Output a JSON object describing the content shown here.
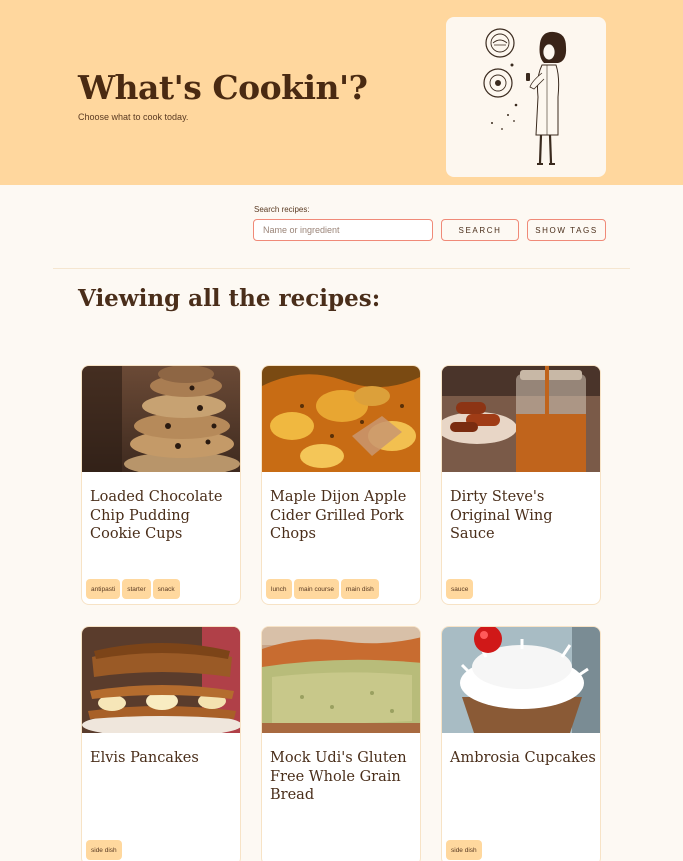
{
  "header": {
    "title": "What's Cookin'?",
    "subtitle": "Choose what to cook today."
  },
  "search": {
    "label": "Search recipes:",
    "placeholder": "Name or ingredient",
    "search_button": "SEARCH",
    "tags_button": "SHOW TAGS"
  },
  "main": {
    "heading": "Viewing all the recipes:"
  },
  "recipes": [
    {
      "title": "Loaded Chocolate Chip Pudding Cookie Cups",
      "tags": [
        "antipasti",
        "starter",
        "snack"
      ]
    },
    {
      "title": "Maple Dijon Apple Cider Grilled Pork Chops",
      "tags": [
        "lunch",
        "main course",
        "main dish"
      ]
    },
    {
      "title": "Dirty Steve's Original Wing Sauce",
      "tags": [
        "sauce"
      ]
    },
    {
      "title": "Elvis Pancakes",
      "tags": [
        "side dish"
      ]
    },
    {
      "title": "Mock Udi's Gluten Free Whole Grain Bread",
      "tags": []
    },
    {
      "title": "Ambrosia Cupcakes",
      "tags": [
        "side dish"
      ]
    }
  ],
  "colors": {
    "header_bg": "#ffd79e",
    "page_bg": "#fdf9f3",
    "accent_border": "#f08a78",
    "tag_bg": "#ffd89e",
    "text": "#4a2e1a"
  }
}
